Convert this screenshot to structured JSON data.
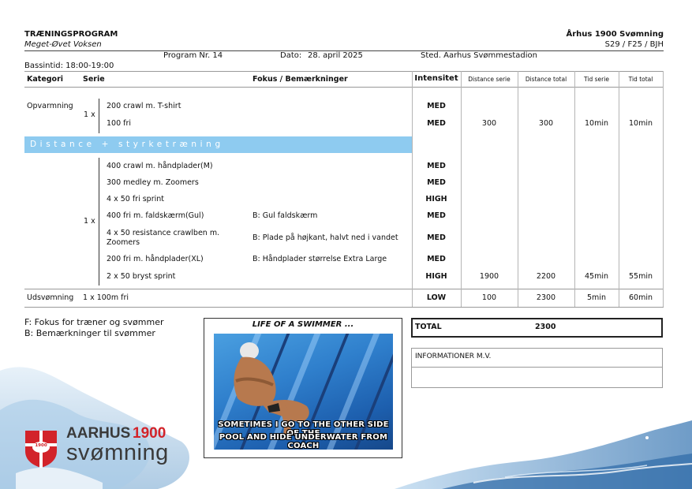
{
  "header": {
    "title": "TRÆNINGSPROGRAM",
    "subtitle": "Meget-Øvet Voksen",
    "club": "Århus 1900 Svømning",
    "code": "S29 / F25 / BJH",
    "program": "Program Nr. 14",
    "date_label": "Dato:",
    "date": "28. april 2025",
    "location": "Sted. Aarhus Svømmestadion",
    "pool_time": "Bassintid: 18:00-19:00"
  },
  "table": {
    "columns": [
      "Kategori",
      "Serie",
      "Fokus / Bemærkninger",
      "Intensitet",
      "Distance serie",
      "Distance total",
      "Tid serie",
      "Tid total"
    ],
    "warmup": {
      "category": "Opvarmning",
      "repeat": "1 x",
      "rows": [
        {
          "serie": "200 crawl m. T-shirt",
          "note": "",
          "intensity": "MED"
        },
        {
          "serie": "100 fri",
          "note": "",
          "intensity": "MED",
          "dist_serie": "300",
          "dist_total": "300",
          "time_serie": "10min",
          "time_total": "10min"
        }
      ]
    },
    "main": {
      "section_title": "Distance + styrketræning",
      "repeat": "1 x",
      "rows": [
        {
          "serie": "400 crawl m. håndplader(M)",
          "note": "",
          "intensity": "MED"
        },
        {
          "serie": "300 medley m. Zoomers",
          "note": "",
          "intensity": "MED"
        },
        {
          "serie": "4 x 50 fri sprint",
          "note": "",
          "intensity": "HIGH"
        },
        {
          "serie": "400 fri m. faldskærm(Gul)",
          "note": "B: Gul faldskærm",
          "intensity": "MED"
        },
        {
          "serie": "4 x 50 resistance crawlben m. Zoomers",
          "note": "B: Plade på højkant, halvt ned i vandet",
          "intensity": "MED"
        },
        {
          "serie": "200 fri m. håndplader(XL)",
          "note": "B: Håndplader størrelse Extra Large",
          "intensity": "MED"
        },
        {
          "serie": "2 x 50 bryst sprint",
          "note": "",
          "intensity": "HIGH",
          "dist_serie": "1900",
          "dist_total": "2200",
          "time_serie": "45min",
          "time_total": "55min"
        }
      ]
    },
    "cooldown": {
      "category": "Udsvømning",
      "serie": "1 x 100m fri",
      "intensity": "LOW",
      "dist_serie": "100",
      "dist_total": "2300",
      "time_serie": "5min",
      "time_total": "60min"
    }
  },
  "legend": {
    "f": "F: Fokus for træner og svømmer",
    "b": "B: Bemærkninger til svømmer"
  },
  "meme": {
    "title": "LIFE OF A SWIMMER ...",
    "caption_line1": "SOMETIMES I GO TO THE OTHER SIDE OF THE",
    "caption_line2": "POOL AND HIDE UNDERWATER FROM COACH"
  },
  "total": {
    "label": "TOTAL",
    "value": "2300"
  },
  "info": {
    "label": "INFORMATIONER M.V."
  },
  "logo": {
    "line1": "AARHUS",
    "year": "1900",
    "line2": "svømning",
    "badge_year": "1900",
    "colors": {
      "red": "#d2232a",
      "dark": "#3a3a3a"
    }
  },
  "colors": {
    "band": "#8ecbf0",
    "water": "#7fb4dc"
  }
}
